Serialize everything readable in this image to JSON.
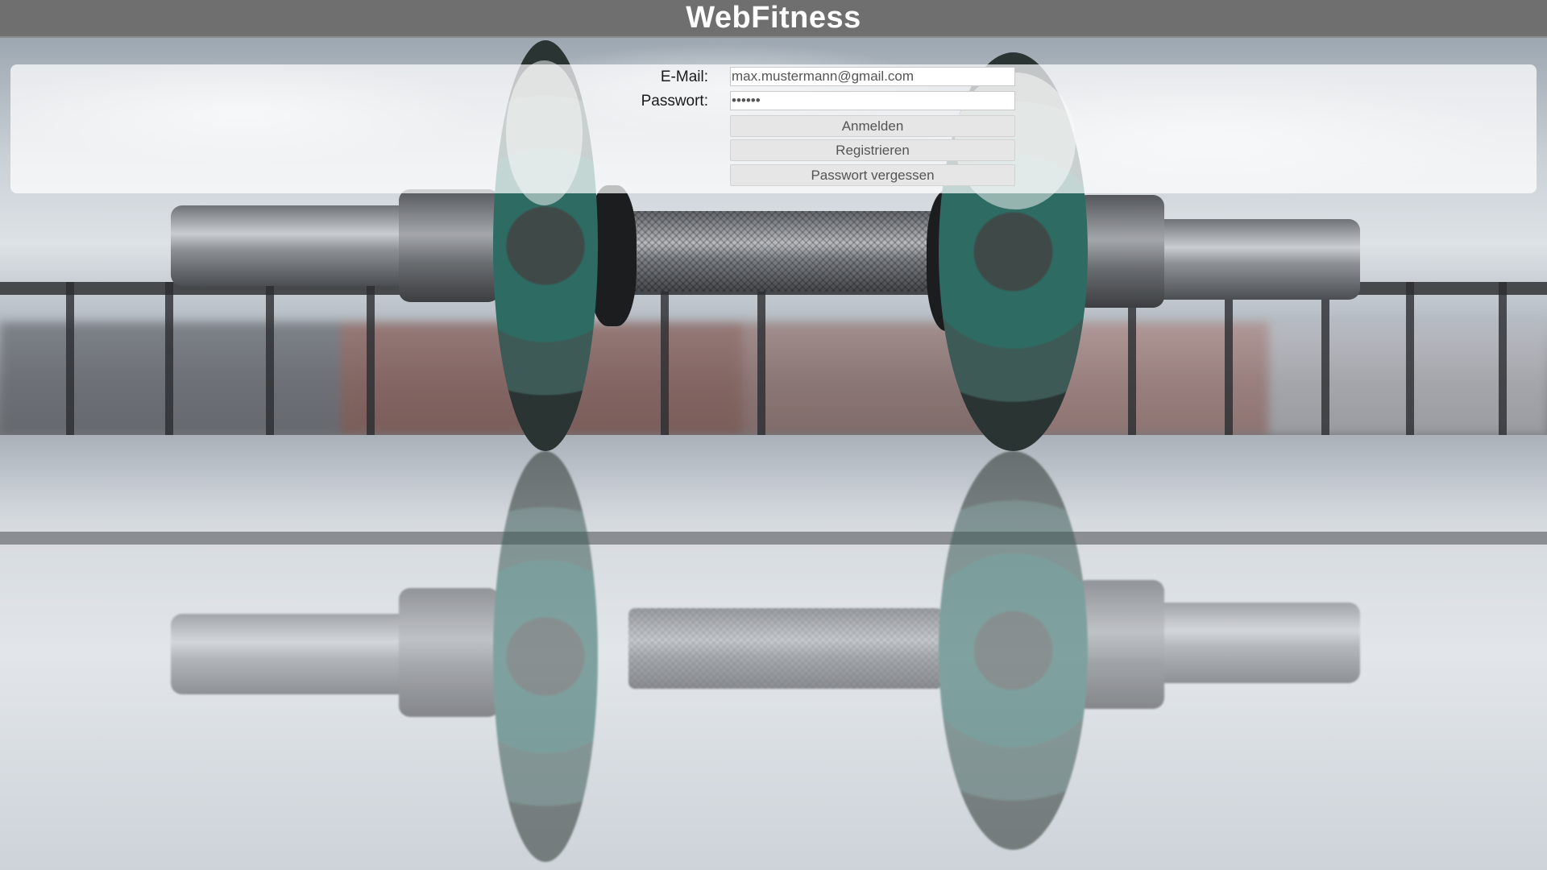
{
  "header": {
    "title": "WebFitness"
  },
  "login": {
    "email_label": "E-Mail:",
    "email_value": "max.mustermann@gmail.com",
    "password_label": "Passwort:",
    "password_value": "••••••",
    "login_button": "Anmelden",
    "register_button": "Registrieren",
    "forgot_button": "Passwort vergessen"
  },
  "colors": {
    "header_bg": "#6f6f6f",
    "header_text": "#ffffff",
    "panel_bg": "rgba(255,255,255,0.72)",
    "button_bg": "#e6e6e6"
  }
}
